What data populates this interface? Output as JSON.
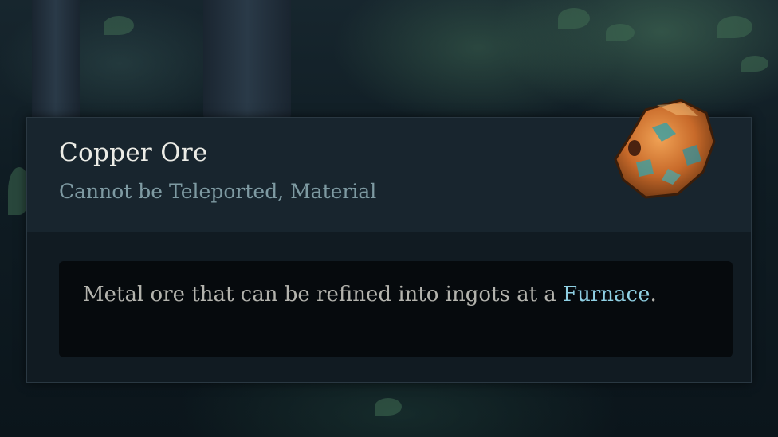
{
  "item": {
    "name": "Copper Ore",
    "tags": "Cannot be Teleported, Material",
    "icon": "copper-ore-icon",
    "description_before": "Metal ore that can be refined into ingots at a ",
    "description_keyword": "Furnace",
    "description_after": "."
  },
  "colors": {
    "title": "#ecece6",
    "tags": "#7e9aa2",
    "keyword": "#8fd0e3",
    "panel": "#111b22"
  }
}
